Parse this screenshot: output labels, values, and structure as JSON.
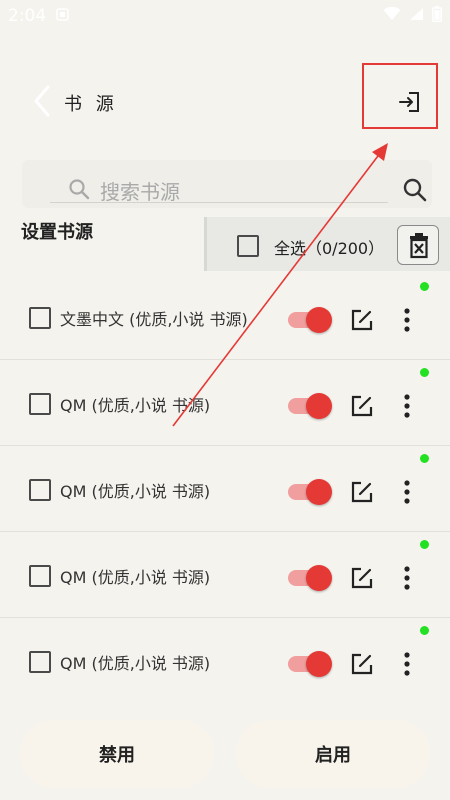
{
  "status_bar": {
    "time": "2:04"
  },
  "header": {
    "title": "书 源",
    "back_icon": "chevron-left-icon",
    "import_icon": "import-icon"
  },
  "search": {
    "placeholder": "搜索书源"
  },
  "section": {
    "title": "设置书源"
  },
  "selection": {
    "select_all_label": "全选（0/200）"
  },
  "sources": [
    {
      "label": "文墨中文 (优质,小说 书源)",
      "enabled": true
    },
    {
      "label": "QM (优质,小说 书源)",
      "enabled": true
    },
    {
      "label": "QM (优质,小说 书源)",
      "enabled": true
    },
    {
      "label": "QM (优质,小说 书源)",
      "enabled": true
    },
    {
      "label": "QM (优质,小说 书源)",
      "enabled": true
    }
  ],
  "footer": {
    "disable_label": "禁用",
    "enable_label": "启用"
  },
  "colors": {
    "accent": "#e53935",
    "status_dot": "#22e022",
    "background": "#f4f3ee"
  }
}
